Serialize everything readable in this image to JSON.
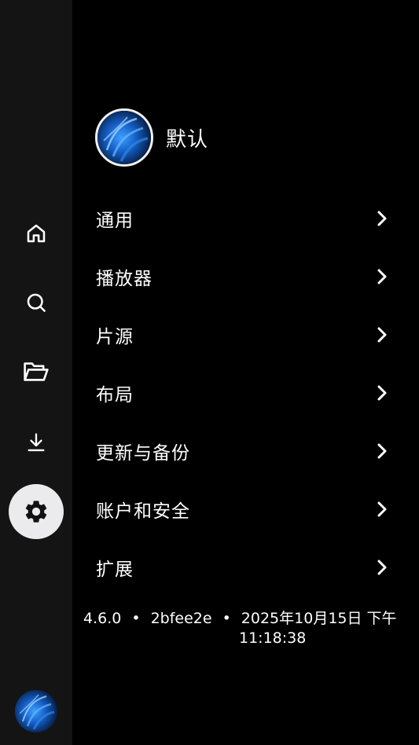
{
  "nav": {
    "items": [
      {
        "id": "home",
        "icon": "home-icon",
        "active": false
      },
      {
        "id": "search",
        "icon": "search-icon",
        "active": false
      },
      {
        "id": "folder",
        "icon": "folder-open-icon",
        "active": false
      },
      {
        "id": "download",
        "icon": "download-icon",
        "active": false
      },
      {
        "id": "settings",
        "icon": "gear-icon",
        "active": true
      }
    ],
    "active_bg": "#ebebed",
    "rail_bg": "#141414"
  },
  "profile": {
    "name": "默认"
  },
  "menu": [
    {
      "label": "通用"
    },
    {
      "label": "播放器"
    },
    {
      "label": "片源"
    },
    {
      "label": "布局"
    },
    {
      "label": "更新与备份"
    },
    {
      "label": "账户和安全"
    },
    {
      "label": "扩展"
    }
  ],
  "version": {
    "number": "4.6.0",
    "commit": "2bfee2e",
    "separator": "•",
    "date": "2025年10月15日 下午",
    "time": "11:18:38"
  }
}
